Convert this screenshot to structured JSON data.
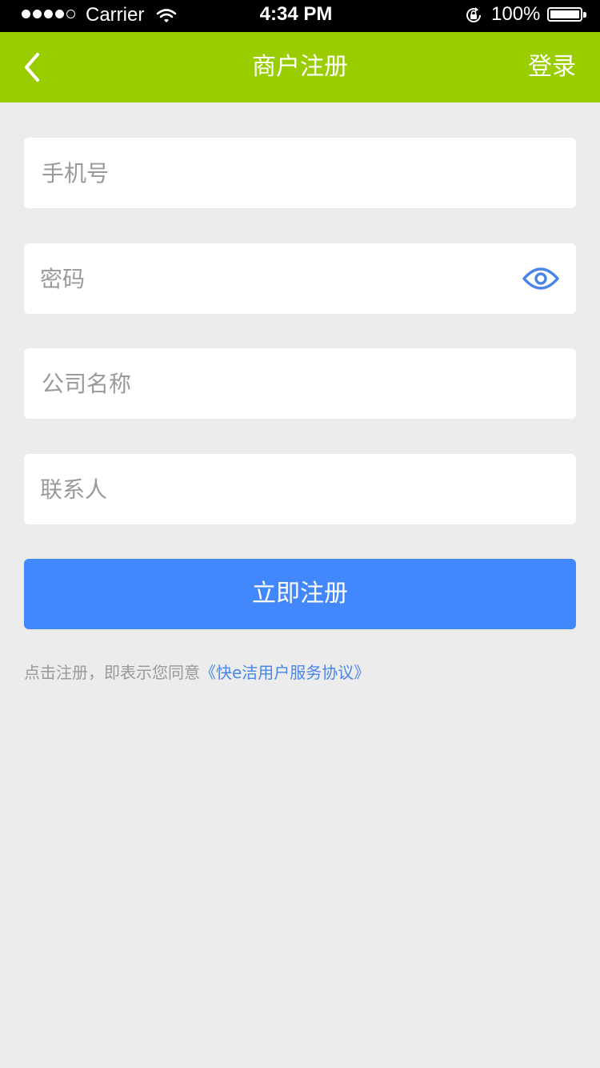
{
  "status_bar": {
    "carrier": "Carrier",
    "time": "4:34 PM",
    "battery": "100%"
  },
  "nav": {
    "back_icon": "chevron-left-icon",
    "title": "商户注册",
    "login_label": "登录"
  },
  "form": {
    "phone_placeholder": "手机号",
    "password_placeholder": "密码",
    "password_toggle_icon": "eye-icon",
    "company_placeholder": "公司名称",
    "contact_placeholder": "联系人",
    "submit_label": "立即注册"
  },
  "agreement": {
    "prefix": "点击注册，即表示您同意",
    "link": "《快e洁用户服务协议》"
  },
  "colors": {
    "nav_bg": "#9acd00",
    "primary": "#4287fb",
    "link": "#4a86e8",
    "page_bg": "#ececec"
  }
}
